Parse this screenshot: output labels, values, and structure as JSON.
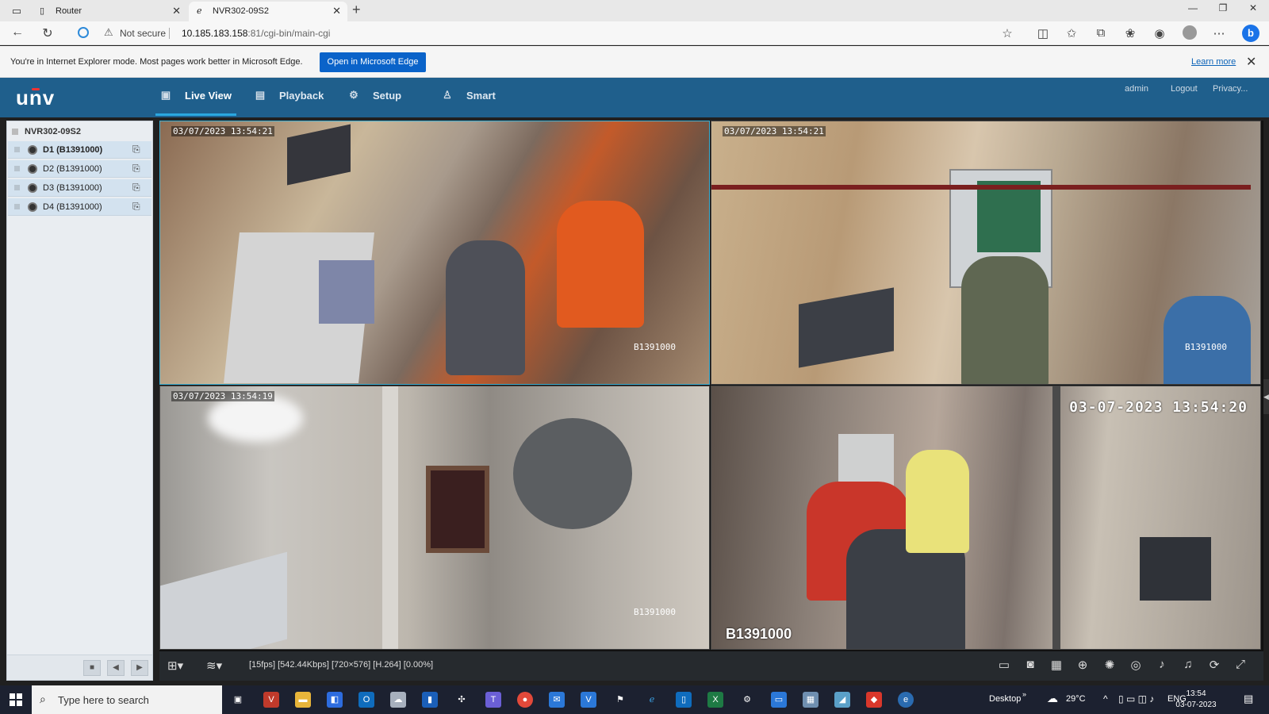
{
  "browser": {
    "tabs": [
      {
        "title": "Router",
        "active": false
      },
      {
        "title": "NVR302-09S2",
        "active": true
      }
    ],
    "not_secure": "Not secure",
    "url_host": "10.185.183.158",
    "url_path": ":81/cgi-bin/main-cgi",
    "ie_mode_message": "You're in Internet Explorer mode. Most pages work better in Microsoft Edge.",
    "open_in_edge": "Open in Microsoft Edge",
    "learn_more": "Learn more"
  },
  "app": {
    "logo": "unv",
    "nav": [
      {
        "label": "Live View",
        "icon": "monitor-icon",
        "active": true
      },
      {
        "label": "Playback",
        "icon": "film-icon",
        "active": false
      },
      {
        "label": "Setup",
        "icon": "gear-icon",
        "active": false
      },
      {
        "label": "Smart",
        "icon": "person-icon",
        "active": false
      }
    ],
    "header_links": {
      "user": "admin",
      "logout": "Logout",
      "privacy": "Privacy..."
    }
  },
  "device_tree": {
    "root": "NVR302-09S2",
    "channels": [
      {
        "label": "D1 (B1391000)",
        "selected": true
      },
      {
        "label": "D2 (B1391000)",
        "selected": false
      },
      {
        "label": "D3 (B1391000)",
        "selected": false
      },
      {
        "label": "D4 (B1391000)",
        "selected": false
      }
    ]
  },
  "video": {
    "cells": [
      {
        "timestamp": "03/07/2023 13:54:21",
        "camera": "B1391000",
        "style": "small"
      },
      {
        "timestamp": "03/07/2023 13:54:21",
        "camera": "B1391000",
        "style": "small"
      },
      {
        "timestamp": "03/07/2023 13:54:19",
        "camera": "B1391000",
        "style": "small"
      },
      {
        "timestamp": "03-07-2023 13:54:20",
        "camera": "B1391000",
        "style": "big"
      }
    ],
    "status": "[15fps] [542.44Kbps] [720×576] [H.264] [0.00%]"
  },
  "taskbar": {
    "search_placeholder": "Type here to search",
    "desktop": "Desktop",
    "weather": "29°C",
    "lang": "ENG",
    "time": "13:54",
    "date": "03-07-2023"
  },
  "colors": {
    "header": "#1f5f8c",
    "accent": "#2aa7e0",
    "edge_button": "#0a63c9"
  }
}
